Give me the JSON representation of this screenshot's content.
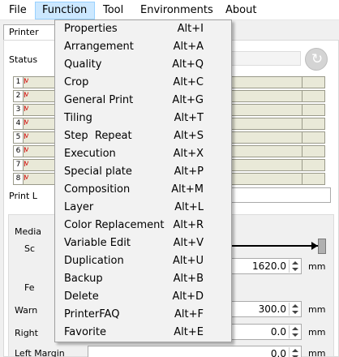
{
  "menubar": {
    "items": [
      {
        "label": "File"
      },
      {
        "label": "Function"
      },
      {
        "label": "Tool"
      },
      {
        "label": "Environments"
      },
      {
        "label": "About"
      }
    ]
  },
  "background": {
    "tab_label": "Printer",
    "status_label": "Status",
    "rows": [
      "1",
      "2",
      "3",
      "4",
      "5",
      "6",
      "7",
      "8"
    ],
    "row_mark": "M",
    "print_label": "Print L",
    "media_label": "Media",
    "sc_label": "Sc",
    "fe_label": "Fe",
    "warn_label": "Warn",
    "right_label": "Right",
    "left_margin_label": "Left Margin",
    "fields": {
      "value1": "1620.0",
      "value2": "300.0",
      "value3": "0.0",
      "value4": "0.0"
    },
    "unit": "mm"
  },
  "function_menu": {
    "items": [
      {
        "label": "Properties",
        "shortcut": "Alt+I"
      },
      {
        "label": "Arrangement",
        "shortcut": "Alt+A"
      },
      {
        "label": "Quality",
        "shortcut": "Alt+Q"
      },
      {
        "label": "Crop",
        "shortcut": "Alt+C"
      },
      {
        "label": "General Print",
        "shortcut": "Alt+G"
      },
      {
        "label": "Tiling",
        "shortcut": "Alt+T"
      },
      {
        "label": "Step  Repeat",
        "shortcut": "Alt+S"
      },
      {
        "label": "Execution",
        "shortcut": "Alt+X"
      },
      {
        "label": "Special plate",
        "shortcut": "Alt+P"
      },
      {
        "label": "Composition",
        "shortcut": "Alt+M"
      },
      {
        "label": "Layer",
        "shortcut": "Alt+L"
      },
      {
        "label": "Color Replacement",
        "shortcut": "Alt+R"
      },
      {
        "label": "Variable Edit",
        "shortcut": "Alt+V"
      },
      {
        "label": "Duplication",
        "shortcut": "Alt+U"
      },
      {
        "label": "Backup",
        "shortcut": "Alt+B"
      },
      {
        "label": "Delete",
        "shortcut": "Alt+D"
      },
      {
        "label": "PrinterFAQ",
        "shortcut": "Alt+F"
      },
      {
        "label": "Favorite",
        "shortcut": "Alt+E"
      }
    ]
  }
}
